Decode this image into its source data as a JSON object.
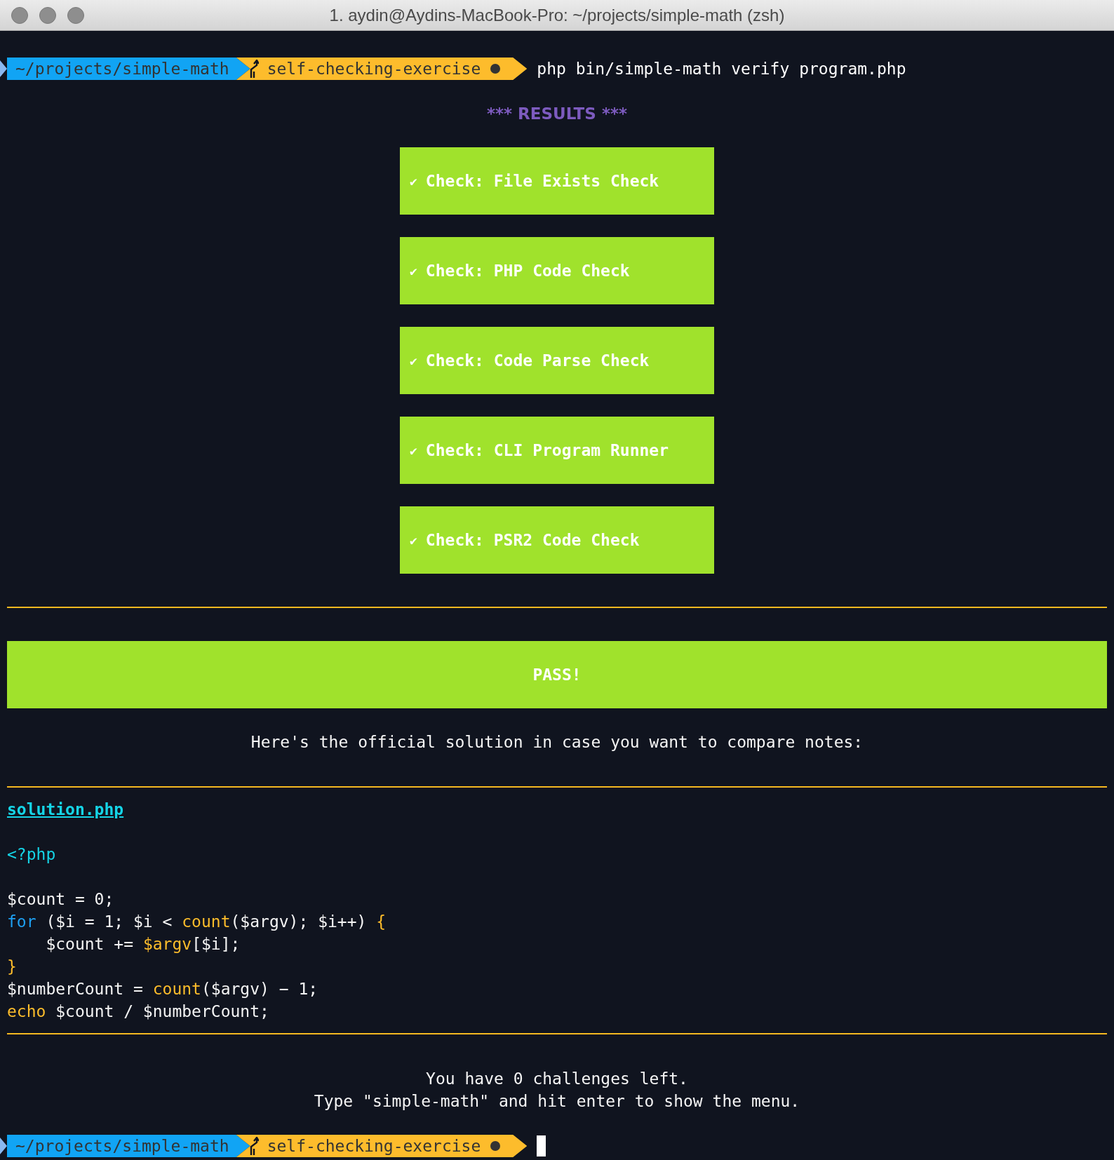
{
  "window": {
    "title": "1. aydin@Aydins-MacBook-Pro: ~/projects/simple-math (zsh)"
  },
  "prompt_top": {
    "path": "~/projects/simple-math",
    "branch": "self-checking-exercise",
    "dirty": true,
    "command": "php bin/simple-math verify program.php"
  },
  "results_heading": "*** RESULTS ***",
  "checks": [
    {
      "mark": "✔",
      "label": "Check: File Exists Check",
      "passed": true
    },
    {
      "mark": "✔",
      "label": "Check: PHP Code Check",
      "passed": true
    },
    {
      "mark": "✔",
      "label": "Check: Code Parse Check",
      "passed": true
    },
    {
      "mark": "✔",
      "label": "Check: CLI Program Runner",
      "passed": true
    },
    {
      "mark": "✔",
      "label": "Check: PSR2 Code Check",
      "passed": true
    }
  ],
  "verdict": {
    "text": "PASS!",
    "passed": true
  },
  "solution_intro": "Here's the official solution in case you want to compare notes:",
  "solution": {
    "file": "solution.php",
    "open_tag": "<?php",
    "lines": [
      [
        {
          "text": "$count = 0;",
          "kind": "plain"
        }
      ],
      [
        {
          "text": "for",
          "kind": "keyword"
        },
        {
          "text": " ($i = 1; $i < ",
          "kind": "plain"
        },
        {
          "text": "count",
          "kind": "function"
        },
        {
          "text": "($argv); $i++) ",
          "kind": "plain"
        },
        {
          "text": "{",
          "kind": "function"
        }
      ],
      [
        {
          "text": "    $count += ",
          "kind": "plain"
        },
        {
          "text": "$argv",
          "kind": "function"
        },
        {
          "text": "[$i];",
          "kind": "plain"
        }
      ],
      [
        {
          "text": "}",
          "kind": "function"
        }
      ],
      [
        {
          "text": "$numberCount = ",
          "kind": "plain"
        },
        {
          "text": "count",
          "kind": "function"
        },
        {
          "text": "($argv) − 1;",
          "kind": "plain"
        }
      ],
      [
        {
          "text": "echo",
          "kind": "function"
        },
        {
          "text": " $count / $numberCount;",
          "kind": "plain"
        }
      ]
    ]
  },
  "footer": [
    "You have 0 challenges left.",
    "Type \"simple-math\" and hit enter to show the menu."
  ],
  "prompt_bottom": {
    "path": "~/projects/simple-math",
    "branch": "self-checking-exercise",
    "dirty": true,
    "cursor": true
  }
}
